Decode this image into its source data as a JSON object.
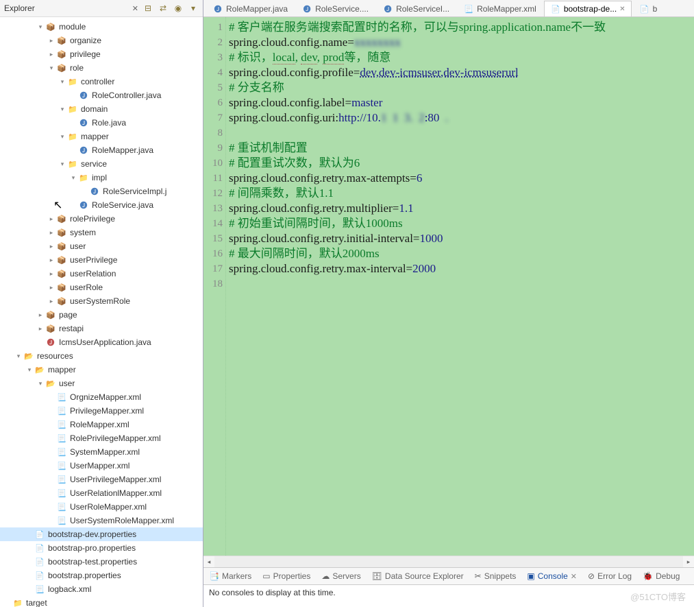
{
  "sidebar": {
    "title": "Explorer",
    "tree": [
      {
        "d": 3,
        "tw": "v",
        "ic": "pkg",
        "label": "module"
      },
      {
        "d": 4,
        "tw": ">",
        "ic": "pkg",
        "label": "organize"
      },
      {
        "d": 4,
        "tw": ">",
        "ic": "pkg",
        "label": "privilege"
      },
      {
        "d": 4,
        "tw": "v",
        "ic": "pkg",
        "label": "role"
      },
      {
        "d": 5,
        "tw": "v",
        "ic": "folder",
        "label": "controller"
      },
      {
        "d": 6,
        "tw": "",
        "ic": "java",
        "label": "RoleController.java"
      },
      {
        "d": 5,
        "tw": "v",
        "ic": "folder",
        "label": "domain"
      },
      {
        "d": 6,
        "tw": "",
        "ic": "java",
        "label": "Role.java"
      },
      {
        "d": 5,
        "tw": "v",
        "ic": "folder",
        "label": "mapper"
      },
      {
        "d": 6,
        "tw": "",
        "ic": "java",
        "label": "RoleMapper.java"
      },
      {
        "d": 5,
        "tw": "v",
        "ic": "folder",
        "label": "service"
      },
      {
        "d": 6,
        "tw": "v",
        "ic": "folder",
        "label": "impl"
      },
      {
        "d": 7,
        "tw": "",
        "ic": "java",
        "label": "RoleServiceImpl.j"
      },
      {
        "d": 6,
        "tw": "",
        "ic": "java",
        "label": "RoleService.java"
      },
      {
        "d": 4,
        "tw": ">",
        "ic": "pkg",
        "label": "rolePrivilege"
      },
      {
        "d": 4,
        "tw": ">",
        "ic": "pkg",
        "label": "system"
      },
      {
        "d": 4,
        "tw": ">",
        "ic": "pkg",
        "label": "user"
      },
      {
        "d": 4,
        "tw": ">",
        "ic": "pkg",
        "label": "userPrivilege"
      },
      {
        "d": 4,
        "tw": ">",
        "ic": "pkg",
        "label": "userRelation"
      },
      {
        "d": 4,
        "tw": ">",
        "ic": "pkg",
        "label": "userRole"
      },
      {
        "d": 4,
        "tw": ">",
        "ic": "pkg",
        "label": "userSystemRole"
      },
      {
        "d": 3,
        "tw": ">",
        "ic": "pkg",
        "label": "page"
      },
      {
        "d": 3,
        "tw": ">",
        "ic": "pkg",
        "label": "restapi"
      },
      {
        "d": 3,
        "tw": "",
        "ic": "app",
        "label": "IcmsUserApplication.java"
      },
      {
        "d": 1,
        "tw": "v",
        "ic": "folder-open",
        "label": "resources"
      },
      {
        "d": 2,
        "tw": "v",
        "ic": "folder-open",
        "label": "mapper"
      },
      {
        "d": 3,
        "tw": "v",
        "ic": "folder-open",
        "label": "user"
      },
      {
        "d": 4,
        "tw": "",
        "ic": "xml",
        "label": "OrgnizeMapper.xml"
      },
      {
        "d": 4,
        "tw": "",
        "ic": "xml",
        "label": "PrivilegeMapper.xml"
      },
      {
        "d": 4,
        "tw": "",
        "ic": "xml",
        "label": "RoleMapper.xml"
      },
      {
        "d": 4,
        "tw": "",
        "ic": "xml",
        "label": "RolePrivilegeMapper.xml"
      },
      {
        "d": 4,
        "tw": "",
        "ic": "xml",
        "label": "SystemMapper.xml"
      },
      {
        "d": 4,
        "tw": "",
        "ic": "xml",
        "label": "UserMapper.xml"
      },
      {
        "d": 4,
        "tw": "",
        "ic": "xml",
        "label": "UserPrivilegeMapper.xml"
      },
      {
        "d": 4,
        "tw": "",
        "ic": "xml",
        "label": "UserRelationlMapper.xml"
      },
      {
        "d": 4,
        "tw": "",
        "ic": "xml",
        "label": "UserRoleMapper.xml"
      },
      {
        "d": 4,
        "tw": "",
        "ic": "xml",
        "label": "UserSystemRoleMapper.xml"
      },
      {
        "d": 2,
        "tw": "",
        "ic": "file",
        "label": "bootstrap-dev.properties",
        "sel": true
      },
      {
        "d": 2,
        "tw": "",
        "ic": "file",
        "label": "bootstrap-pro.properties"
      },
      {
        "d": 2,
        "tw": "",
        "ic": "file",
        "label": "bootstrap-test.properties"
      },
      {
        "d": 2,
        "tw": "",
        "ic": "file",
        "label": "bootstrap.properties"
      },
      {
        "d": 2,
        "tw": "",
        "ic": "xml",
        "label": "logback.xml"
      },
      {
        "d": 0,
        "tw": "",
        "ic": "folder",
        "label": "target"
      }
    ]
  },
  "tabs": [
    {
      "ic": "java",
      "label": "RoleMapper.java"
    },
    {
      "ic": "java",
      "label": "RoleService...."
    },
    {
      "ic": "java",
      "label": "RoleServiceI..."
    },
    {
      "ic": "xml",
      "label": "RoleMapper.xml"
    },
    {
      "ic": "file",
      "label": "bootstrap-de...",
      "active": true,
      "x": true
    },
    {
      "ic": "file",
      "label": "b"
    }
  ],
  "code": {
    "lines": [
      {
        "n": 1,
        "t": "cmt",
        "text": "# 客户端在服务端搜索配置时的名称，可以与spring.application.name不一致"
      },
      {
        "n": 2,
        "parts": [
          {
            "c": "key",
            "t": "spring.cloud.config.name="
          },
          {
            "c": "val blur",
            "t": "xxxxxxxx"
          }
        ]
      },
      {
        "n": 3,
        "t": "cmt",
        "parts": [
          {
            "c": "cmt",
            "t": "# 标识，"
          },
          {
            "c": "cmt underlined",
            "t": "local"
          },
          {
            "c": "cmt",
            "t": ", "
          },
          {
            "c": "cmt underlined",
            "t": "dev"
          },
          {
            "c": "cmt",
            "t": ", "
          },
          {
            "c": "cmt underlined",
            "t": "prod"
          },
          {
            "c": "cmt",
            "t": "等，随意"
          }
        ]
      },
      {
        "n": 4,
        "parts": [
          {
            "c": "key",
            "t": "spring.cloud.config.profile="
          },
          {
            "c": "url",
            "t": "dev,dev-icmsuser,dev-icmsuserurl"
          }
        ]
      },
      {
        "n": 5,
        "t": "cmt",
        "text": "# 分支名称"
      },
      {
        "n": 6,
        "parts": [
          {
            "c": "key",
            "t": "spring.cloud.config.label="
          },
          {
            "c": "val",
            "t": "master"
          }
        ]
      },
      {
        "n": 7,
        "parts": [
          {
            "c": "key",
            "t": "spring.cloud.config.uri:"
          },
          {
            "c": "val",
            "t": "http://10."
          },
          {
            "c": "val blur",
            "t": "1  1  3.  2"
          },
          {
            "c": "val",
            "t": ":80"
          },
          {
            "c": "val blur",
            "t": "  ."
          }
        ]
      },
      {
        "n": 8,
        "text": ""
      },
      {
        "n": 9,
        "t": "cmt",
        "text": "# 重试机制配置"
      },
      {
        "n": 10,
        "t": "cmt",
        "text": "# 配置重试次数，默认为6"
      },
      {
        "n": 11,
        "parts": [
          {
            "c": "key",
            "t": "spring.cloud.config.retry.max-attempts="
          },
          {
            "c": "val",
            "t": "6"
          }
        ]
      },
      {
        "n": 12,
        "t": "cmt",
        "text": "# 间隔乘数，默认1.1"
      },
      {
        "n": 13,
        "parts": [
          {
            "c": "key",
            "t": "spring.cloud.config.retry.multiplier="
          },
          {
            "c": "val",
            "t": "1.1"
          }
        ]
      },
      {
        "n": 14,
        "t": "cmt",
        "text": "# 初始重试间隔时间，默认1000ms"
      },
      {
        "n": 15,
        "parts": [
          {
            "c": "key",
            "t": "spring.cloud.config.retry.initial-interval="
          },
          {
            "c": "val",
            "t": "1000"
          }
        ]
      },
      {
        "n": 16,
        "t": "cmt",
        "text": "# 最大间隔时间，默认2000ms"
      },
      {
        "n": 17,
        "parts": [
          {
            "c": "key",
            "t": "spring.cloud.config.retry.max-interval="
          },
          {
            "c": "val",
            "t": "2000"
          }
        ]
      },
      {
        "n": 18,
        "text": ""
      }
    ]
  },
  "bottomTabs": [
    {
      "ic": "📑",
      "label": "Markers"
    },
    {
      "ic": "▭",
      "label": "Properties"
    },
    {
      "ic": "☁",
      "label": "Servers"
    },
    {
      "ic": "🗄",
      "label": "Data Source Explorer"
    },
    {
      "ic": "✂",
      "label": "Snippets"
    },
    {
      "ic": "▣",
      "label": "Console",
      "active": true,
      "x": true
    },
    {
      "ic": "⊘",
      "label": "Error Log"
    },
    {
      "ic": "🐞",
      "label": "Debug"
    }
  ],
  "bottomPanel": {
    "empty": "No consoles to display at this time."
  },
  "watermark": "@51CTO博客"
}
